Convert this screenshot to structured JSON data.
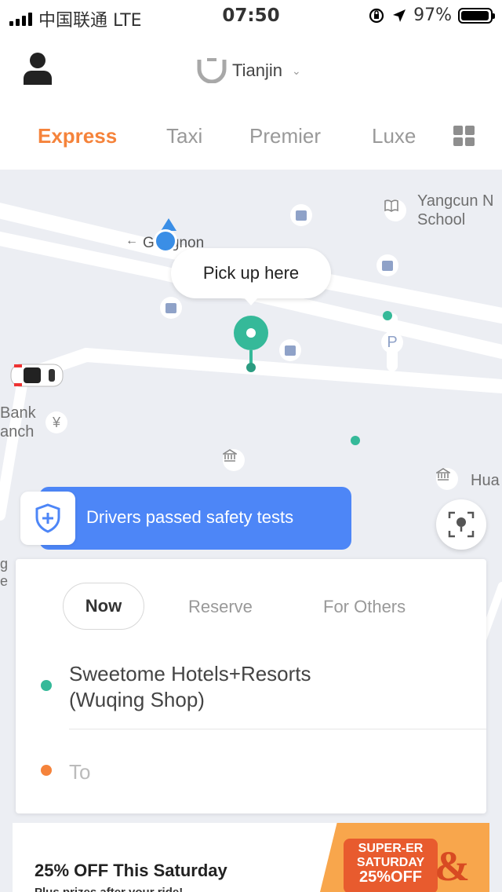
{
  "status_bar": {
    "carrier": "中国联通 LTE",
    "time": "07:50",
    "battery": "97%",
    "battery_level": 0.97
  },
  "header": {
    "city": "Tianjin",
    "profile_icon": "person-icon",
    "logo_icon": "brand-logo-icon",
    "dropdown_icon": "chevron-down-icon"
  },
  "tabs": [
    {
      "label": "Express",
      "active": true
    },
    {
      "label": "Taxi",
      "active": false
    },
    {
      "label": "Premier",
      "active": false
    },
    {
      "label": "Luxe",
      "active": false
    }
  ],
  "more_icon": "grid-icon",
  "map": {
    "labels": {
      "school": "Yangcun N\nSchool",
      "road": "Gongnon",
      "bank_1": "Bank",
      "bank_2": "anch",
      "hua": "Hua",
      "bottom_left_1": "g",
      "bottom_left_2": "e"
    },
    "pickup_label": "Pick up here",
    "parking": "P",
    "yuan": "¥"
  },
  "safety_banner": {
    "text": "Drivers passed safety tests",
    "icon": "shield-plus-icon"
  },
  "locate_icon": "locate-pin-icon",
  "booking": {
    "modes": [
      {
        "label": "Now",
        "active": true
      },
      {
        "label": "Reserve",
        "active": false
      },
      {
        "label": "For Others",
        "active": false
      }
    ],
    "from": "Sweetome Hotels+Resorts\n(Wuqing Shop)",
    "to_placeholder": "To",
    "colors": {
      "from": "#35b999",
      "to": "#f5833b"
    }
  },
  "promo": {
    "title": "25% OFF This Saturday",
    "subtitle": "Plus prizes after your ride!",
    "badge_line1": "SUPER-ER",
    "badge_line2": "SATURDAY",
    "badge_line3": "25%OFF",
    "amp": "&"
  },
  "colors": {
    "accent": "#f5833b",
    "pin": "#35b999",
    "banner": "#4d86f7",
    "location": "#3a8ee6"
  }
}
